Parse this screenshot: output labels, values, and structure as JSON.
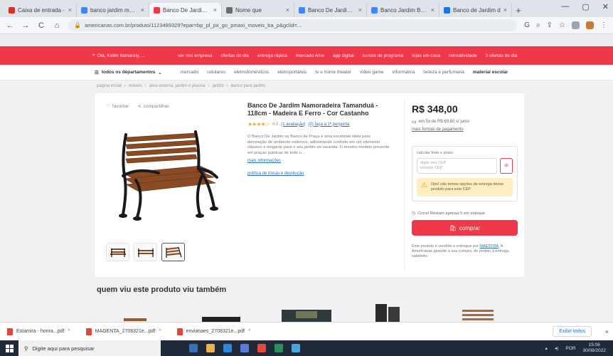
{
  "browser": {
    "tabs": [
      {
        "title": "Caixa de entrada - ",
        "color": "#d93025",
        "active": false
      },
      {
        "title": "banco jardim madeir",
        "color": "#4285f4",
        "active": false
      },
      {
        "title": "Banco De Jardim N",
        "color": "#ef3849",
        "active": true
      },
      {
        "title": "Nome que",
        "color": "#6d6d6d",
        "active": false
      },
      {
        "title": "Banco De Jardim N",
        "color": "#4285f4",
        "active": false
      },
      {
        "title": "Banco Jardim Brasil",
        "color": "#4285f4",
        "active": false
      },
      {
        "title": "Banco de Jardim d",
        "color": "#1a73e8",
        "active": false
      }
    ],
    "new_tab": "+",
    "url": "americanas.com.br/produto/1123489329?epar=bp_pl_px_go_pmaxi_moveis_ba_p&gclid=...",
    "back": "←",
    "forward": "→",
    "reload": "C",
    "home": "⌂"
  },
  "site": {
    "redbar_address": "Olá, Kelim Itamaraty, ...",
    "redbar_links": [
      "ver nos empresa",
      "ofertas do dia",
      "entrega rápida",
      "mercado Ame",
      "app digital",
      "cursos de programa",
      "lojas em casa",
      "retroatividade",
      "3 ofertas do dia"
    ],
    "dept_menu_label": "todos os departamentos",
    "dept_links": [
      "mercado",
      "celulares",
      "eletrodomésticos",
      "eletroportáteis",
      "tv e home theater",
      "video game",
      "informática",
      "beleza e perfumaria"
    ],
    "dept_last": "material escolar",
    "breadcrumb": [
      "página inicial",
      "móveis",
      "área externa, jardim e piscina",
      "jardim",
      "banco para jardim"
    ]
  },
  "product": {
    "share_label": "favoritar",
    "compare_label": "compartilhar",
    "title": "Banco De Jardim Namoradeira Tamanduá - 118cm - Madeira E Ferro - Cor Castanho",
    "stars": "★★★★☆",
    "rating_value": "4.0",
    "rating_count": "(1 avaliação)",
    "questions_link": "(0) faça a 1ª pergunta",
    "description": "O Banco De Jardim ou Banco de Praça é uma excelente ideia para decoração de ambiente externos, adicionando conforto em um elemento clássico e elegante para o seu jardim ou varanda. O mesmo modelo presente em praças públicas de todo o...",
    "more_info_link": "mais informações",
    "extra_link": "política de trocas e devolução",
    "price": "R$ 348,00",
    "installments": "em 5x de R$ 69,60 s/ juros",
    "payment_link": "mais formas de pagamento",
    "cep_label": "calcular frete e prazo",
    "cep_placeholder": "digite seu CEP",
    "cep_hint": "informe CEP",
    "cep_button": "ok",
    "alert_text": "Ops! não temos opções de entrega desse produto para este CEP",
    "stock_text": "Corra! Restam apenas 5 em estoque",
    "buy_label": "comprar",
    "seller_note_prefix": "Este produto é vendido e entregue por",
    "seller_name": "MAESTRA",
    "seller_note_suffix": ". A Americanas garante a sua compra, do pedido à entrega, satisfeito."
  },
  "recommendations": {
    "heading": "quem viu este produto viu também"
  },
  "downloads": {
    "items": [
      "Estamira - honra...pdf",
      "MAGENTA_2708321e...pdf",
      "envianaes_2708321e...pdf"
    ],
    "show_all": "Exibir todos",
    "close": "×"
  },
  "taskbar": {
    "search_placeholder": "Digite aqui para pesquisar",
    "time": "15:06",
    "date": "30/08/2022",
    "lang": "POR"
  }
}
